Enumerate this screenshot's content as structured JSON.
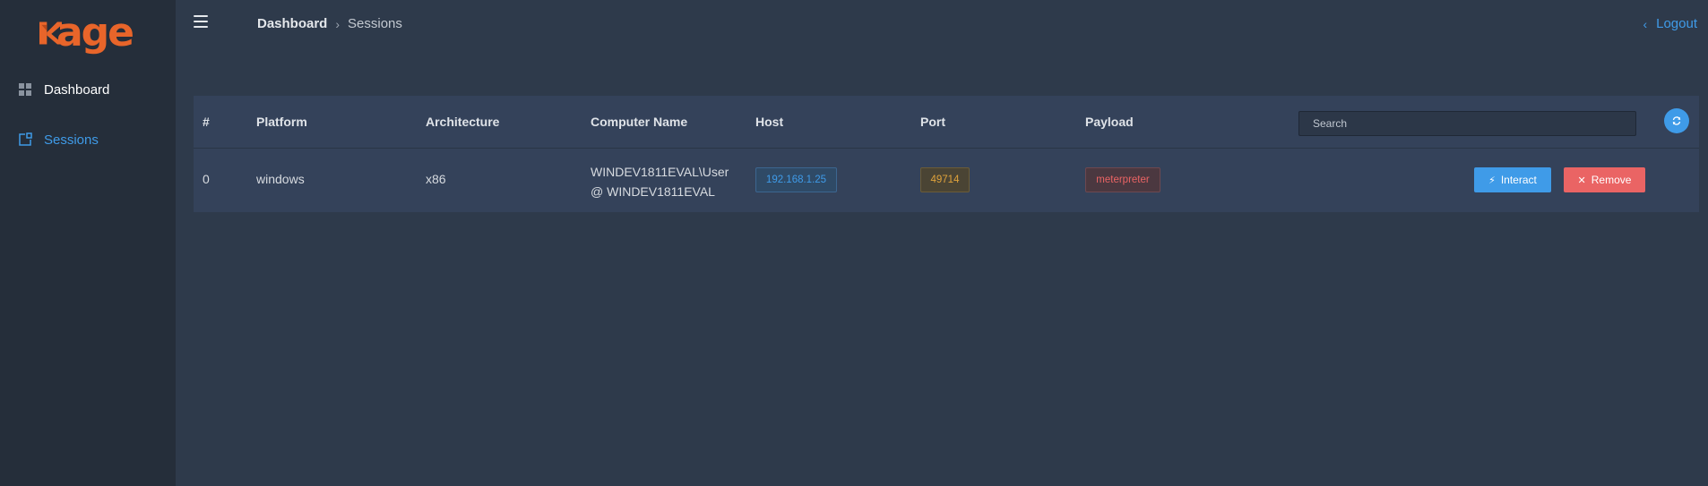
{
  "app": {
    "logo_text": "age",
    "brand_color": "#e8652a",
    "accent": "#3f9be8",
    "danger": "#ea6464",
    "warning": "#e0a33b"
  },
  "sidebar": {
    "items": [
      {
        "label": "Dashboard",
        "icon": "grid-icon",
        "active": false
      },
      {
        "label": "Sessions",
        "icon": "sessions-icon",
        "active": true
      }
    ]
  },
  "header": {
    "breadcrumb": {
      "root": "Dashboard",
      "current": "Sessions"
    },
    "logout_label": "Logout"
  },
  "table": {
    "columns": [
      "#",
      "Platform",
      "Architecture",
      "Computer Name",
      "Host",
      "Port",
      "Payload"
    ],
    "search_placeholder": "Search",
    "rows": [
      {
        "id": "0",
        "platform": "windows",
        "architecture": "x86",
        "computer_name_line1": "WINDEV1811EVAL\\User",
        "computer_name_line2": "@ WINDEV1811EVAL",
        "host": "192.168.1.25",
        "port": "49714",
        "payload": "meterpreter",
        "actions": {
          "interact": "Interact",
          "remove": "Remove"
        }
      }
    ]
  }
}
